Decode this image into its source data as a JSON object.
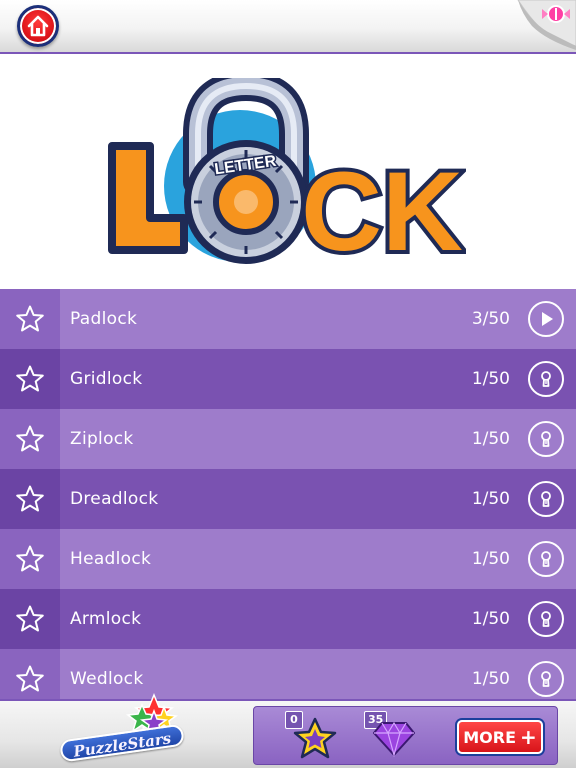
{
  "header": {
    "home_icon": "home-icon",
    "corner_badge_icon": "candy-icon"
  },
  "logo": {
    "word_small": "LETTER",
    "word_large": "LOCK"
  },
  "levels": [
    {
      "name": "Padlock",
      "progress": "3/50",
      "action_icon": "play-icon",
      "starred": false
    },
    {
      "name": "Gridlock",
      "progress": "1/50",
      "action_icon": "keyhole-lock-icon",
      "starred": false
    },
    {
      "name": "Ziplock",
      "progress": "1/50",
      "action_icon": "keyhole-lock-icon",
      "starred": false
    },
    {
      "name": "Dreadlock",
      "progress": "1/50",
      "action_icon": "keyhole-lock-icon",
      "starred": false
    },
    {
      "name": "Headlock",
      "progress": "1/50",
      "action_icon": "keyhole-lock-icon",
      "starred": false
    },
    {
      "name": "Armlock",
      "progress": "1/50",
      "action_icon": "keyhole-lock-icon",
      "starred": false
    },
    {
      "name": "Wedlock",
      "progress": "1/50",
      "action_icon": "keyhole-lock-icon",
      "starred": false
    }
  ],
  "footer": {
    "brand": "PuzzleStars",
    "stars_count": "0",
    "gems_count": "35",
    "more_label": "MORE",
    "more_plus": "+"
  },
  "colors": {
    "row_light": "#9e7ccb",
    "row_dark": "#7a52b1",
    "accent_purple": "#7b56b8",
    "logo_orange": "#f7941d",
    "logo_navy": "#1f2a55",
    "home_red": "#e0161b"
  }
}
